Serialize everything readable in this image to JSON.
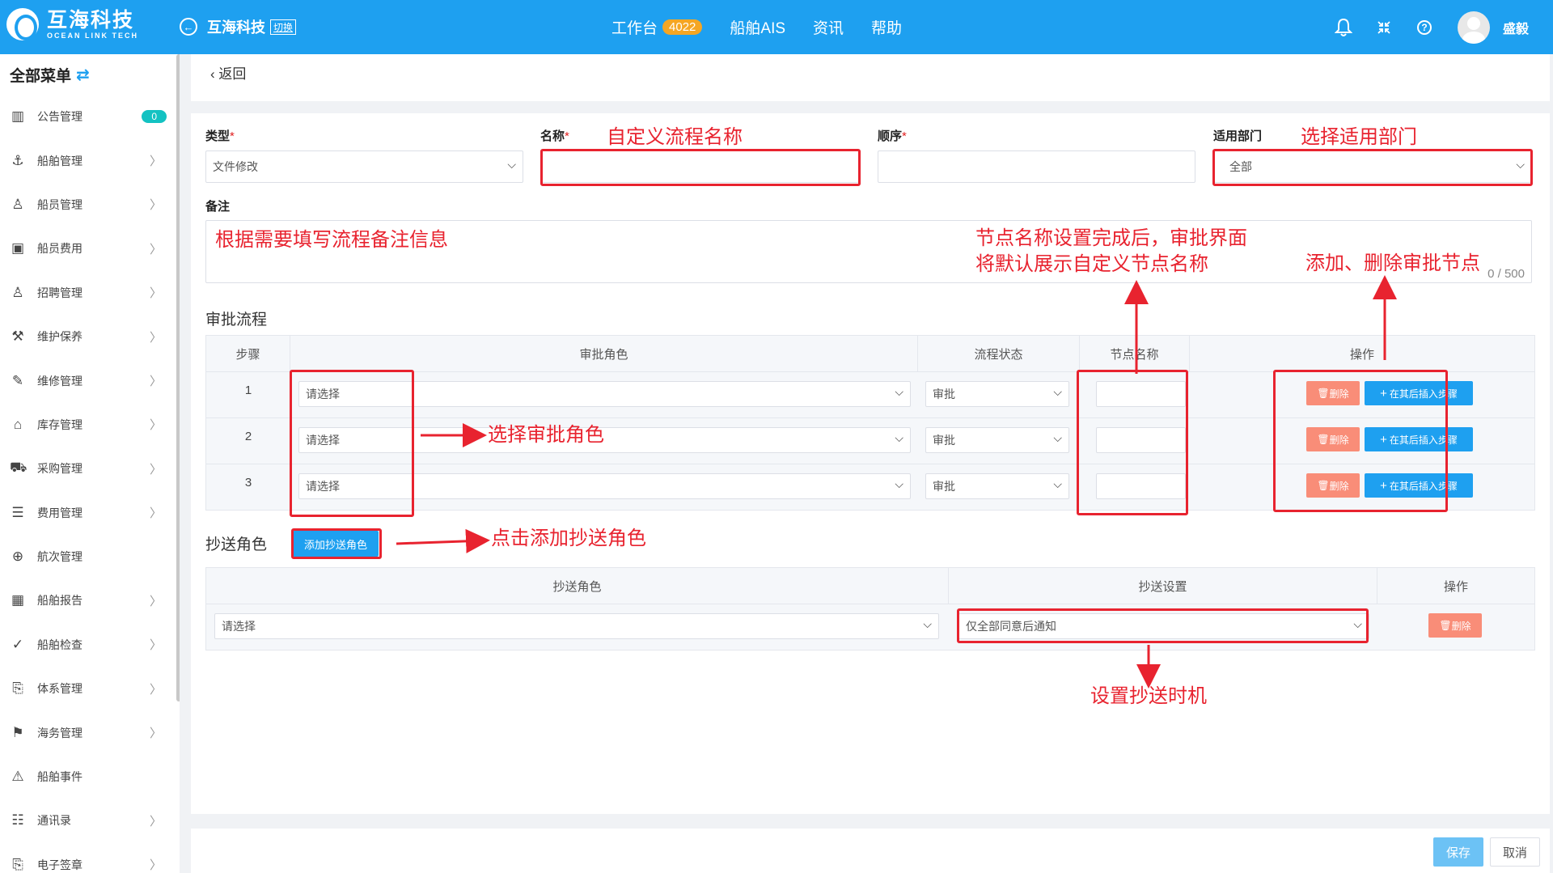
{
  "topbar": {
    "logo_cn": "互海科技",
    "logo_en": "OCEAN LINK TECH",
    "brand": "互海科技",
    "switch": "切换",
    "nav": [
      "工作台",
      "船舶AIS",
      "资讯",
      "帮助"
    ],
    "badge": "4022",
    "user": "盛毅"
  },
  "sidebar": {
    "title": "全部菜单",
    "notice_count": "0",
    "items": [
      "公告管理",
      "船舶管理",
      "船员管理",
      "船员费用",
      "招聘管理",
      "维护保养",
      "维修管理",
      "库存管理",
      "采购管理",
      "费用管理",
      "航次管理",
      "船舶报告",
      "船舶检查",
      "体系管理",
      "海务管理",
      "船舶事件",
      "通讯录",
      "电子签章"
    ]
  },
  "back": "返回",
  "form": {
    "type_label": "类型",
    "type_value": "文件修改",
    "name_label": "名称",
    "order_label": "顺序",
    "dept_label": "适用部门",
    "dept_value": "全部",
    "remark_label": "备注",
    "counter": "0 / 500",
    "required_mark": "*"
  },
  "approval": {
    "title": "审批流程",
    "headers": [
      "步骤",
      "审批角色",
      "流程状态",
      "节点名称",
      "操作"
    ],
    "rows": [
      {
        "step": "1",
        "role": "请选择",
        "status": "审批"
      },
      {
        "step": "2",
        "role": "请选择",
        "status": "审批"
      },
      {
        "step": "3",
        "role": "请选择",
        "status": "审批"
      }
    ],
    "delete": "删除",
    "insert": "在其后插入步骤"
  },
  "cc": {
    "title": "抄送角色",
    "add_button": "添加抄送角色",
    "headers": [
      "抄送角色",
      "抄送设置",
      "操作"
    ],
    "role_value": "请选择",
    "setting_value": "仅全部同意后通知",
    "delete": "删除"
  },
  "footer": {
    "save": "保存",
    "cancel": "取消"
  },
  "annotations": {
    "name": "自定义流程名称",
    "dept": "选择适用部门",
    "remark": "根据需要填写流程备注信息",
    "node_line1": "节点名称设置完成后，审批界面",
    "node_line2": "将默认展示自定义节点名称",
    "ops": "添加、删除审批节点",
    "role": "选择审批角色",
    "add_cc": "点击添加抄送角色",
    "cc_timing": "设置抄送时机"
  },
  "colors": {
    "primary": "#1ea0f0",
    "danger": "#f98d78",
    "annotation": "#e8232f",
    "badge": "#f5a623"
  }
}
